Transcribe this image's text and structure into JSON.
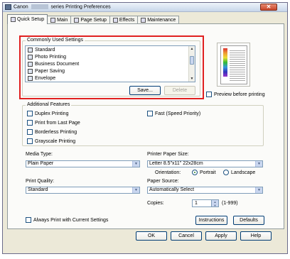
{
  "window": {
    "title_prefix": "Canon",
    "title_suffix": "series Printing Preferences",
    "close_glyph": "✕"
  },
  "tabs": [
    {
      "label": "Quick Setup",
      "icon": "quick-setup-icon"
    },
    {
      "label": "Main",
      "icon": "main-icon"
    },
    {
      "label": "Page Setup",
      "icon": "page-setup-icon"
    },
    {
      "label": "Effects",
      "icon": "effects-icon"
    },
    {
      "label": "Maintenance",
      "icon": "maintenance-icon"
    }
  ],
  "commonly_used": {
    "title": "Commonly Used Settings",
    "items": [
      "Standard",
      "Photo Printing",
      "Business Document",
      "Paper Saving",
      "Envelope"
    ],
    "save_label": "Save...",
    "delete_label": "Delete"
  },
  "preview": {
    "label": "Preview before printing"
  },
  "features": {
    "title": "Additional Features",
    "duplex": "Duplex Printing",
    "last_page": "Print from Last Page",
    "borderless": "Borderless Printing",
    "grayscale": "Grayscale Printing",
    "fast": "Fast (Speed Priority)"
  },
  "media": {
    "label": "Media Type:",
    "value": "Plain Paper"
  },
  "paper_size": {
    "label": "Printer Paper Size:",
    "value": "Letter 8.5\"x11\" 22x28cm"
  },
  "orientation": {
    "label": "Orientation:",
    "portrait": "Portrait",
    "landscape": "Landscape"
  },
  "quality": {
    "label": "Print Quality:",
    "value": "Standard"
  },
  "source": {
    "label": "Paper Source:",
    "value": "Automatically Select"
  },
  "copies": {
    "label": "Copies:",
    "value": "1",
    "range": "(1-999)"
  },
  "always_print": "Always Print with Current Settings",
  "instructions_label": "Instructions",
  "defaults_label": "Defaults",
  "footer": {
    "ok": "OK",
    "cancel": "Cancel",
    "apply": "Apply",
    "help": "Help"
  },
  "colors": {
    "highlight": "#e02020",
    "xp_border": "#003c74"
  }
}
